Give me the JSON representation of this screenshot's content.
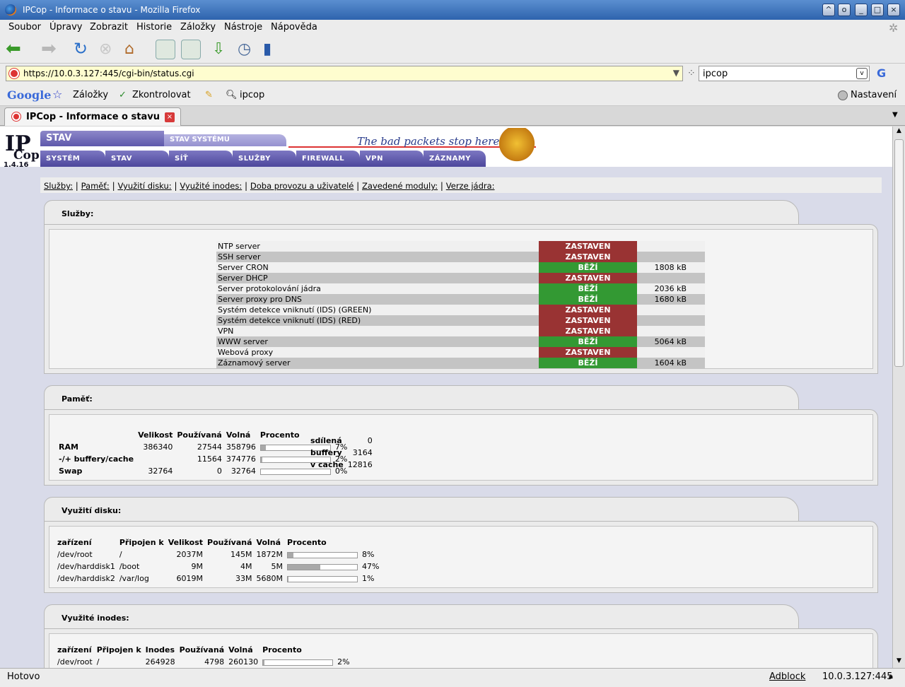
{
  "window": {
    "title": "IPCop - Informace o stavu - Mozilla Firefox"
  },
  "menu": [
    "Soubor",
    "Úpravy",
    "Zobrazit",
    "Historie",
    "Záložky",
    "Nástroje",
    "Nápověda"
  ],
  "url": "https://10.0.3.127:445/cgi-bin/status.cgi",
  "search_value": "ipcop",
  "gbar": {
    "zalozky": "Záložky",
    "zkontrolovat": "Zkontrolovat",
    "ipcop": "ipcop",
    "nastaveni": "Nastavení"
  },
  "tab_title": "IPCop - Informace o stavu",
  "header": {
    "version": "1.4.16",
    "stav": "Stav",
    "stav_systemu": "Stav systému",
    "tagline": "The bad packets stop here.",
    "nav": [
      "Systém",
      "Stav",
      "Síť",
      "Služby",
      "Firewall",
      "VPN",
      "Záznamy"
    ]
  },
  "anchors": [
    "Služby:",
    "Paměť:",
    "Využití disku:",
    "Využité inodes:",
    "Doba provozu a uživatelé",
    "Zavedené moduly:",
    "Verze jádra:"
  ],
  "services": {
    "title": "Služby:",
    "rows": [
      {
        "name": "NTP server",
        "status": "ZASTAVEN",
        "mem": ""
      },
      {
        "name": "SSH server",
        "status": "ZASTAVEN",
        "mem": ""
      },
      {
        "name": "Server CRON",
        "status": "BĚŽÍ",
        "mem": "1808 kB"
      },
      {
        "name": "Server DHCP",
        "status": "ZASTAVEN",
        "mem": ""
      },
      {
        "name": "Server protokolování jádra",
        "status": "BĚŽÍ",
        "mem": "2036 kB"
      },
      {
        "name": "Server proxy pro DNS",
        "status": "BĚŽÍ",
        "mem": "1680 kB"
      },
      {
        "name": "Systém detekce vniknutí (IDS) (GREEN)",
        "status": "ZASTAVEN",
        "mem": ""
      },
      {
        "name": "Systém detekce vniknutí (IDS) (RED)",
        "status": "ZASTAVEN",
        "mem": ""
      },
      {
        "name": "VPN",
        "status": "ZASTAVEN",
        "mem": ""
      },
      {
        "name": "WWW server",
        "status": "BĚŽÍ",
        "mem": "5064 kB"
      },
      {
        "name": "Webová proxy",
        "status": "ZASTAVEN",
        "mem": ""
      },
      {
        "name": "Záznamový server",
        "status": "BĚŽÍ",
        "mem": "1604 kB"
      }
    ]
  },
  "colors": {
    "running": "#339933",
    "stopped": "#993333"
  },
  "memory": {
    "title": "Paměť:",
    "headers": [
      "Velikost",
      "Používaná",
      "Volná",
      "Procento"
    ],
    "rows": [
      {
        "label": "RAM",
        "size": "386340",
        "used": "27544",
        "free": "358796",
        "pct": "7%",
        "frac": 0.07
      },
      {
        "label": "-/+ buffery/cache",
        "size": "",
        "used": "11564",
        "free": "374776",
        "pct": "2%",
        "frac": 0.02
      },
      {
        "label": "Swap",
        "size": "32764",
        "used": "0",
        "free": "32764",
        "pct": "0%",
        "frac": 0
      }
    ],
    "extra": [
      {
        "label": "sdílená",
        "value": "0"
      },
      {
        "label": "buffery",
        "value": "3164"
      },
      {
        "label": "v cache",
        "value": "12816"
      }
    ]
  },
  "disk": {
    "title": "Využití disku:",
    "headers": [
      "zařízení",
      "Připojen k",
      "Velikost",
      "Používaná",
      "Volná",
      "Procento"
    ],
    "rows": [
      {
        "dev": "/dev/root",
        "mnt": "/",
        "size": "2037M",
        "used": "145M",
        "free": "1872M",
        "pct": "8%",
        "frac": 0.08
      },
      {
        "dev": "/dev/harddisk1",
        "mnt": "/boot",
        "size": "9M",
        "used": "4M",
        "free": "5M",
        "pct": "47%",
        "frac": 0.47
      },
      {
        "dev": "/dev/harddisk2",
        "mnt": "/var/log",
        "size": "6019M",
        "used": "33M",
        "free": "5680M",
        "pct": "1%",
        "frac": 0.01
      }
    ]
  },
  "inodes": {
    "title": "Využité inodes:",
    "headers": [
      "zařízení",
      "Připojen k",
      "Inodes",
      "Používaná",
      "Volná",
      "Procento"
    ],
    "rows": [
      {
        "dev": "/dev/root",
        "mnt": "/",
        "size": "264928",
        "used": "4798",
        "free": "260130",
        "pct": "2%",
        "frac": 0.02
      }
    ]
  },
  "status": {
    "text": "Hotovo",
    "adblock": "Adblock",
    "host": "10.0.3.127:445"
  }
}
